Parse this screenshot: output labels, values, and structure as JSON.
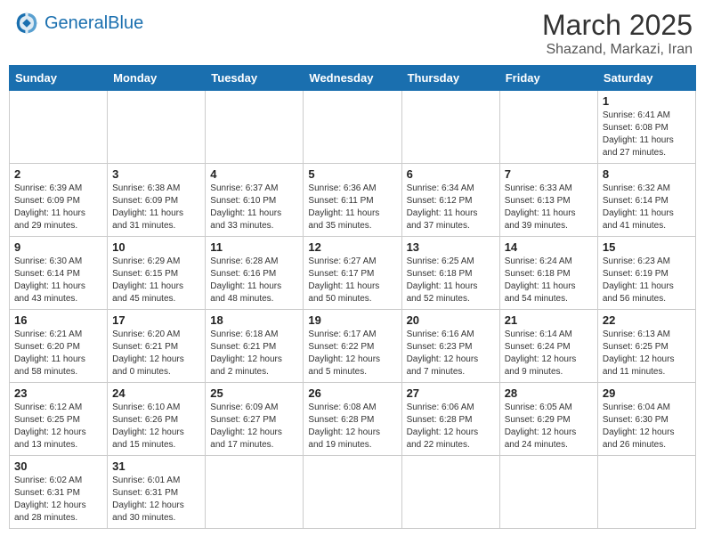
{
  "header": {
    "logo_text_general": "General",
    "logo_text_blue": "Blue",
    "month_title": "March 2025",
    "subtitle": "Shazand, Markazi, Iran"
  },
  "weekdays": [
    "Sunday",
    "Monday",
    "Tuesday",
    "Wednesday",
    "Thursday",
    "Friday",
    "Saturday"
  ],
  "days": [
    {
      "num": "",
      "info": ""
    },
    {
      "num": "",
      "info": ""
    },
    {
      "num": "",
      "info": ""
    },
    {
      "num": "",
      "info": ""
    },
    {
      "num": "",
      "info": ""
    },
    {
      "num": "",
      "info": ""
    },
    {
      "num": "1",
      "info": "Sunrise: 6:41 AM\nSunset: 6:08 PM\nDaylight: 11 hours\nand 27 minutes."
    },
    {
      "num": "2",
      "info": "Sunrise: 6:39 AM\nSunset: 6:09 PM\nDaylight: 11 hours\nand 29 minutes."
    },
    {
      "num": "3",
      "info": "Sunrise: 6:38 AM\nSunset: 6:09 PM\nDaylight: 11 hours\nand 31 minutes."
    },
    {
      "num": "4",
      "info": "Sunrise: 6:37 AM\nSunset: 6:10 PM\nDaylight: 11 hours\nand 33 minutes."
    },
    {
      "num": "5",
      "info": "Sunrise: 6:36 AM\nSunset: 6:11 PM\nDaylight: 11 hours\nand 35 minutes."
    },
    {
      "num": "6",
      "info": "Sunrise: 6:34 AM\nSunset: 6:12 PM\nDaylight: 11 hours\nand 37 minutes."
    },
    {
      "num": "7",
      "info": "Sunrise: 6:33 AM\nSunset: 6:13 PM\nDaylight: 11 hours\nand 39 minutes."
    },
    {
      "num": "8",
      "info": "Sunrise: 6:32 AM\nSunset: 6:14 PM\nDaylight: 11 hours\nand 41 minutes."
    },
    {
      "num": "9",
      "info": "Sunrise: 6:30 AM\nSunset: 6:14 PM\nDaylight: 11 hours\nand 43 minutes."
    },
    {
      "num": "10",
      "info": "Sunrise: 6:29 AM\nSunset: 6:15 PM\nDaylight: 11 hours\nand 45 minutes."
    },
    {
      "num": "11",
      "info": "Sunrise: 6:28 AM\nSunset: 6:16 PM\nDaylight: 11 hours\nand 48 minutes."
    },
    {
      "num": "12",
      "info": "Sunrise: 6:27 AM\nSunset: 6:17 PM\nDaylight: 11 hours\nand 50 minutes."
    },
    {
      "num": "13",
      "info": "Sunrise: 6:25 AM\nSunset: 6:18 PM\nDaylight: 11 hours\nand 52 minutes."
    },
    {
      "num": "14",
      "info": "Sunrise: 6:24 AM\nSunset: 6:18 PM\nDaylight: 11 hours\nand 54 minutes."
    },
    {
      "num": "15",
      "info": "Sunrise: 6:23 AM\nSunset: 6:19 PM\nDaylight: 11 hours\nand 56 minutes."
    },
    {
      "num": "16",
      "info": "Sunrise: 6:21 AM\nSunset: 6:20 PM\nDaylight: 11 hours\nand 58 minutes."
    },
    {
      "num": "17",
      "info": "Sunrise: 6:20 AM\nSunset: 6:21 PM\nDaylight: 12 hours\nand 0 minutes."
    },
    {
      "num": "18",
      "info": "Sunrise: 6:18 AM\nSunset: 6:21 PM\nDaylight: 12 hours\nand 2 minutes."
    },
    {
      "num": "19",
      "info": "Sunrise: 6:17 AM\nSunset: 6:22 PM\nDaylight: 12 hours\nand 5 minutes."
    },
    {
      "num": "20",
      "info": "Sunrise: 6:16 AM\nSunset: 6:23 PM\nDaylight: 12 hours\nand 7 minutes."
    },
    {
      "num": "21",
      "info": "Sunrise: 6:14 AM\nSunset: 6:24 PM\nDaylight: 12 hours\nand 9 minutes."
    },
    {
      "num": "22",
      "info": "Sunrise: 6:13 AM\nSunset: 6:25 PM\nDaylight: 12 hours\nand 11 minutes."
    },
    {
      "num": "23",
      "info": "Sunrise: 6:12 AM\nSunset: 6:25 PM\nDaylight: 12 hours\nand 13 minutes."
    },
    {
      "num": "24",
      "info": "Sunrise: 6:10 AM\nSunset: 6:26 PM\nDaylight: 12 hours\nand 15 minutes."
    },
    {
      "num": "25",
      "info": "Sunrise: 6:09 AM\nSunset: 6:27 PM\nDaylight: 12 hours\nand 17 minutes."
    },
    {
      "num": "26",
      "info": "Sunrise: 6:08 AM\nSunset: 6:28 PM\nDaylight: 12 hours\nand 19 minutes."
    },
    {
      "num": "27",
      "info": "Sunrise: 6:06 AM\nSunset: 6:28 PM\nDaylight: 12 hours\nand 22 minutes."
    },
    {
      "num": "28",
      "info": "Sunrise: 6:05 AM\nSunset: 6:29 PM\nDaylight: 12 hours\nand 24 minutes."
    },
    {
      "num": "29",
      "info": "Sunrise: 6:04 AM\nSunset: 6:30 PM\nDaylight: 12 hours\nand 26 minutes."
    },
    {
      "num": "30",
      "info": "Sunrise: 6:02 AM\nSunset: 6:31 PM\nDaylight: 12 hours\nand 28 minutes."
    },
    {
      "num": "31",
      "info": "Sunrise: 6:01 AM\nSunset: 6:31 PM\nDaylight: 12 hours\nand 30 minutes."
    },
    {
      "num": "",
      "info": ""
    },
    {
      "num": "",
      "info": ""
    },
    {
      "num": "",
      "info": ""
    },
    {
      "num": "",
      "info": ""
    },
    {
      "num": "",
      "info": ""
    }
  ]
}
